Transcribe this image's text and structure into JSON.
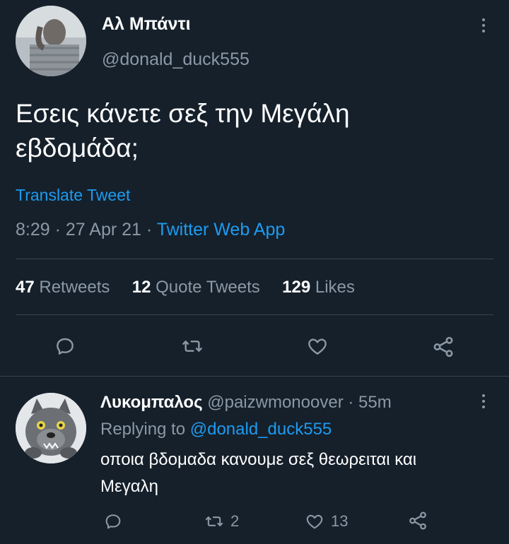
{
  "tweet": {
    "author_name": "Αλ Μπάντι",
    "author_handle": "@donald_duck555",
    "text": "Εσεις κάνετε σεξ την Μεγάλη εβδομάδα;",
    "translate_label": "Translate Tweet",
    "time": "8:29",
    "separator1": "·",
    "date": "27 Apr 21",
    "separator2": "·",
    "source": "Twitter Web App",
    "stats": {
      "retweets_count": "47",
      "retweets_label": "Retweets",
      "quotes_count": "12",
      "quotes_label": "Quote Tweets",
      "likes_count": "129",
      "likes_label": "Likes"
    },
    "icons": [
      "reply-icon",
      "retweet-icon",
      "like-icon",
      "share-icon"
    ]
  },
  "reply": {
    "author_name": "Λυκομπαλος",
    "author_handle": "@paizwmonoover",
    "separator": "·",
    "age": "55m",
    "replying_to_label": "Replying to",
    "replying_to_handle": "@donald_duck555",
    "text_line1": "οποια βδομαδα κανουμε σεξ θεωρειται και",
    "text_line2": "Μεγαλη",
    "retweet_count": "2",
    "like_count": "13"
  },
  "colors": {
    "background": "#15202b",
    "accent": "#1d9bf0",
    "muted": "#8b98a5",
    "divider": "#38444d"
  }
}
